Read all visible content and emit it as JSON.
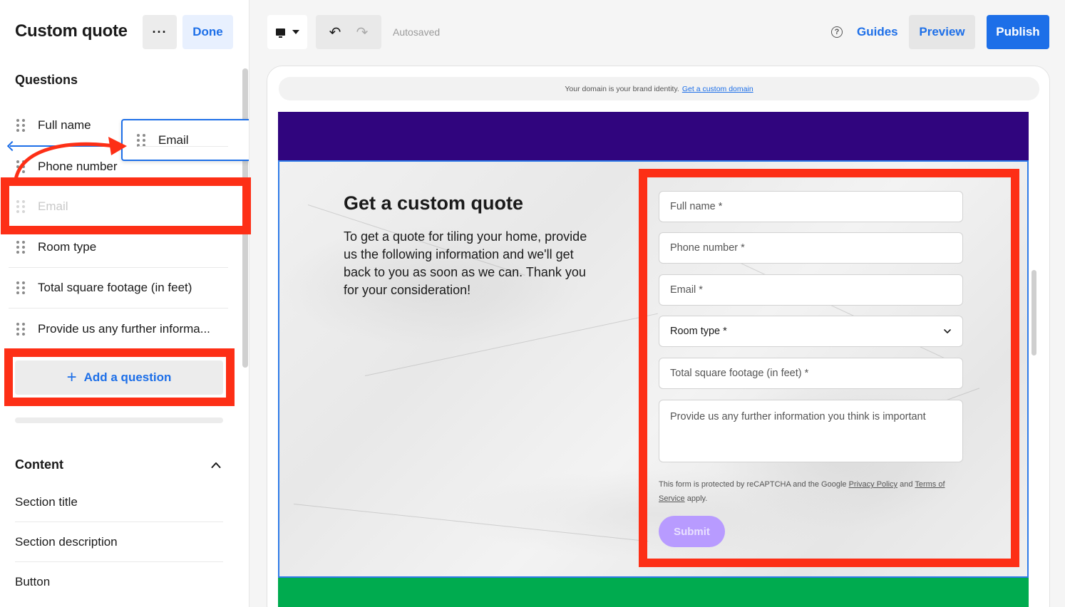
{
  "sidebar": {
    "title": "Custom quote",
    "more_label": "···",
    "done_label": "Done",
    "questions_heading": "Questions",
    "questions": [
      {
        "label": "Full name"
      },
      {
        "label": "Phone number"
      },
      {
        "label": "Email"
      },
      {
        "label": "Room type"
      },
      {
        "label": "Total square footage (in feet)"
      },
      {
        "label": "Provide us any further informa..."
      }
    ],
    "dragging_item": "Email",
    "add_question_label": "Add a question",
    "content_heading": "Content",
    "content_items": [
      {
        "label": "Section title"
      },
      {
        "label": "Section description"
      },
      {
        "label": "Button"
      }
    ]
  },
  "toolbar": {
    "autosaved": "Autosaved",
    "guides": "Guides",
    "preview": "Preview",
    "publish": "Publish"
  },
  "canvas": {
    "domain_text": "Your domain is your brand identity.",
    "domain_link": "Get a custom domain",
    "section_title": "Get a custom quote",
    "section_description": "To get a quote for tiling your home, provide us the following information and we'll get back to you as soon as we can. Thank you for your consideration!",
    "form": {
      "fields": [
        {
          "label": "Full name *"
        },
        {
          "label": "Phone number *"
        },
        {
          "label": "Email *"
        },
        {
          "label": "Room type *"
        },
        {
          "label": "Total square footage (in feet) *"
        },
        {
          "label": "Provide us any further information you think is important"
        }
      ],
      "legal_prefix": "This form is protected by reCAPTCHA and the Google",
      "privacy_link": "Privacy Policy",
      "legal_and": "and",
      "terms_link": "Terms of Service",
      "legal_suffix": "apply.",
      "submit_label": "Submit"
    }
  },
  "colors": {
    "accent": "#1d6fe8",
    "header_band": "#30057e",
    "footer_band": "#00ab4f",
    "submit": "#b89bff",
    "annotation": "#fd2f16"
  },
  "icons": [
    "more-icon",
    "drag-handle-icon",
    "plus-icon",
    "chevron-up-icon",
    "monitor-icon",
    "undo-icon",
    "redo-icon",
    "help-icon",
    "chevron-down-icon"
  ]
}
